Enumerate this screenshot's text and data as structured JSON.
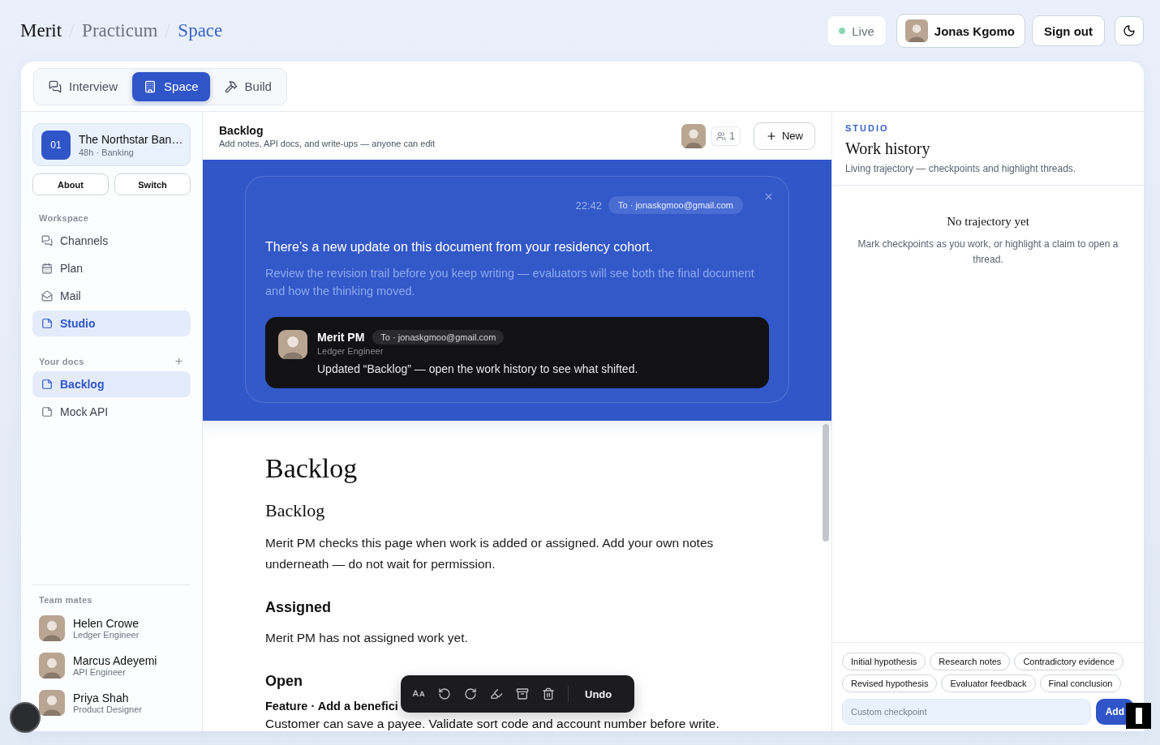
{
  "breadcrumbs": [
    {
      "label": "Merit",
      "kind": "brand"
    },
    {
      "label": "Practicum",
      "kind": "crumb"
    },
    {
      "label": "Space",
      "kind": "current"
    }
  ],
  "status": {
    "label": "Live",
    "on": true
  },
  "user": {
    "name": "Jonas Kgomo"
  },
  "sign_out": "Sign out",
  "tabs": [
    {
      "label": "Interview",
      "kind": "interview",
      "selected": false
    },
    {
      "label": "Space",
      "kind": "space",
      "selected": true
    },
    {
      "label": "Build",
      "kind": "build",
      "selected": false
    }
  ],
  "project": {
    "badge": "01",
    "title": "The Northstar Ban…",
    "meta": "48h · Banking",
    "buttons": [
      "About",
      "Switch"
    ]
  },
  "workspace": {
    "label": "Workspace",
    "items": [
      {
        "label": "Channels",
        "kind": "channels",
        "selected": false
      },
      {
        "label": "Plan",
        "kind": "plan",
        "selected": false
      },
      {
        "label": "Mail",
        "kind": "mail",
        "selected": false
      },
      {
        "label": "Studio",
        "kind": "doc",
        "selected": true
      }
    ]
  },
  "docs": {
    "label": "Your docs",
    "items": [
      {
        "label": "Backlog",
        "selected": true
      },
      {
        "label": "Mock API",
        "selected": false
      }
    ]
  },
  "teammates": {
    "label": "Team mates",
    "members": [
      {
        "name": "Helen Crowe",
        "role": "Ledger Engineer"
      },
      {
        "name": "Marcus Adeyemi",
        "role": "API Engineer"
      },
      {
        "name": "Priya Shah",
        "role": "Product Designer"
      }
    ]
  },
  "doc_header": {
    "title": "Backlog",
    "subtitle": "Add notes, API docs, and write-ups — anyone can edit",
    "viewers": "1",
    "new_button": "New"
  },
  "notice": {
    "time": "22:42",
    "to": "To · jonaskgmoo@gmail.com",
    "heading": "There’s a new update on this document from your residency cohort.",
    "body": "Review the revision trail before you keep writing — evaluators will see both the final document and how the thinking moved.",
    "message": {
      "sender": "Merit PM",
      "to": "To · jonaskgmoo@gmail.com",
      "role": "Ledger Engineer",
      "text": "Updated “Backlog” — open the work history to see what shifted."
    }
  },
  "document": {
    "title": "Backlog",
    "blocks": [
      {
        "kind": "h2",
        "text": "Backlog"
      },
      {
        "kind": "p",
        "text": "Merit PM checks this page when work is added or assigned. Add your own notes underneath — do not wait for permission."
      },
      {
        "kind": "h3",
        "text": "Assigned"
      },
      {
        "kind": "p",
        "text": "Merit PM has not assigned work yet."
      },
      {
        "kind": "h3",
        "text": "Open"
      },
      {
        "kind": "strong",
        "text": "Feature · Add a benefici"
      },
      {
        "kind": "line",
        "text": "Customer can save a payee. Validate sort code and account number before write."
      }
    ]
  },
  "toolbar": {
    "tools": [
      {
        "kind": "text"
      },
      {
        "kind": "undo"
      },
      {
        "kind": "redo"
      },
      {
        "kind": "highlight"
      },
      {
        "kind": "archive"
      },
      {
        "kind": "delete"
      }
    ],
    "undo": "Undo"
  },
  "studio": {
    "eyebrow": "STUDIO",
    "title": "Work history",
    "subtitle": "Living trajectory — checkpoints and highlight threads.",
    "empty_title": "No trajectory yet",
    "empty_text": "Mark checkpoints as you work, or highlight a claim to open a thread.",
    "chips": [
      "Initial hypothesis",
      "Research notes",
      "Contradictory evidence",
      "Revised hypothesis",
      "Evaluator feedback",
      "Final conclusion"
    ],
    "placeholder": "Custom checkpoint",
    "add_button": "Add"
  }
}
